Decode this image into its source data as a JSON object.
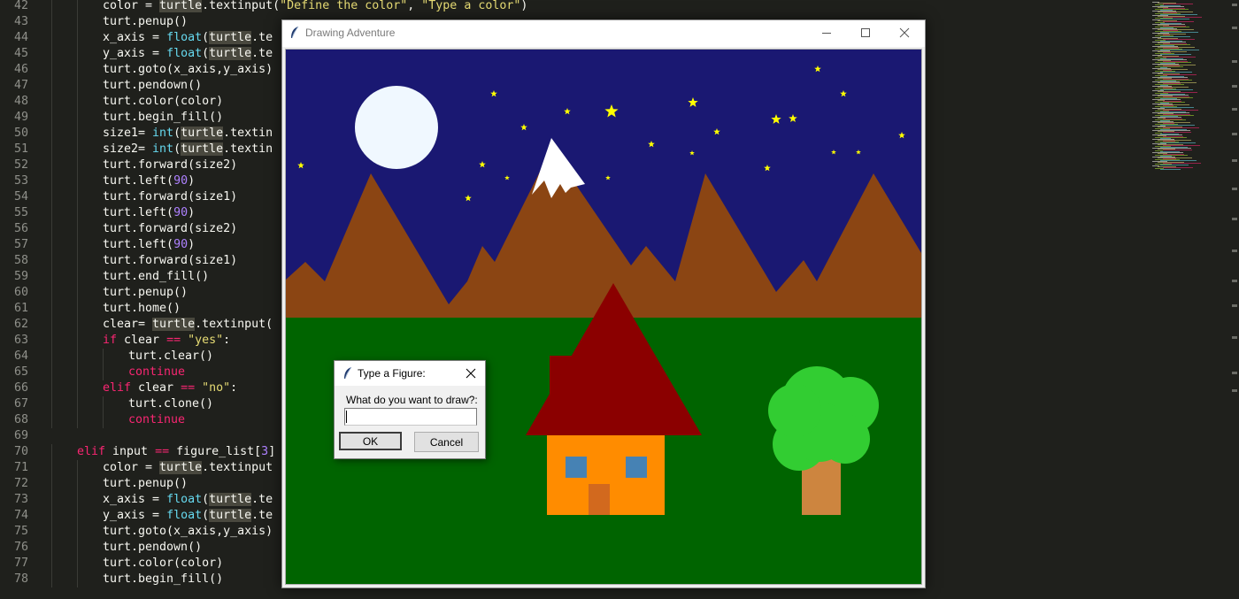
{
  "editor": {
    "lines": [
      {
        "n": "42",
        "indent": 2,
        "tokens": [
          [
            "p",
            "color = "
          ],
          [
            "hl",
            "turtle"
          ],
          [
            "p",
            ".textinput("
          ],
          [
            "s",
            "\"Define the color\""
          ],
          [
            "p",
            ", "
          ],
          [
            "s",
            "\"Type a color\""
          ],
          [
            "p",
            ")"
          ]
        ]
      },
      {
        "n": "43",
        "indent": 2,
        "tokens": [
          [
            "p",
            "turt.penup()"
          ]
        ]
      },
      {
        "n": "44",
        "indent": 2,
        "tokens": [
          [
            "p",
            "x_axis = "
          ],
          [
            "f",
            "float"
          ],
          [
            "p",
            "("
          ],
          [
            "hl",
            "turtle"
          ],
          [
            "p",
            ".te"
          ]
        ]
      },
      {
        "n": "45",
        "indent": 2,
        "tokens": [
          [
            "p",
            "y_axis = "
          ],
          [
            "f",
            "float"
          ],
          [
            "p",
            "("
          ],
          [
            "hl",
            "turtle"
          ],
          [
            "p",
            ".te"
          ]
        ]
      },
      {
        "n": "46",
        "indent": 2,
        "tokens": [
          [
            "p",
            "turt.goto(x_axis,y_axis)"
          ]
        ]
      },
      {
        "n": "47",
        "indent": 2,
        "tokens": [
          [
            "p",
            "turt.pendown()"
          ]
        ]
      },
      {
        "n": "48",
        "indent": 2,
        "tokens": [
          [
            "p",
            "turt.color(color)"
          ]
        ]
      },
      {
        "n": "49",
        "indent": 2,
        "tokens": [
          [
            "p",
            "turt.begin_fill()"
          ]
        ]
      },
      {
        "n": "50",
        "indent": 2,
        "tokens": [
          [
            "p",
            "size1= "
          ],
          [
            "f",
            "int"
          ],
          [
            "p",
            "("
          ],
          [
            "hl",
            "turtle"
          ],
          [
            "p",
            ".textin"
          ]
        ]
      },
      {
        "n": "51",
        "indent": 2,
        "tokens": [
          [
            "p",
            "size2= "
          ],
          [
            "f",
            "int"
          ],
          [
            "p",
            "("
          ],
          [
            "hl",
            "turtle"
          ],
          [
            "p",
            ".textin"
          ]
        ]
      },
      {
        "n": "52",
        "indent": 2,
        "tokens": [
          [
            "p",
            "turt.forward(size2)"
          ]
        ]
      },
      {
        "n": "53",
        "indent": 2,
        "tokens": [
          [
            "p",
            "turt.left("
          ],
          [
            "n",
            "90"
          ],
          [
            "p",
            ")"
          ]
        ]
      },
      {
        "n": "54",
        "indent": 2,
        "tokens": [
          [
            "p",
            "turt.forward(size1)"
          ]
        ]
      },
      {
        "n": "55",
        "indent": 2,
        "tokens": [
          [
            "p",
            "turt.left("
          ],
          [
            "n",
            "90"
          ],
          [
            "p",
            ")"
          ]
        ]
      },
      {
        "n": "56",
        "indent": 2,
        "tokens": [
          [
            "p",
            "turt.forward(size2)"
          ]
        ]
      },
      {
        "n": "57",
        "indent": 2,
        "tokens": [
          [
            "p",
            "turt.left("
          ],
          [
            "n",
            "90"
          ],
          [
            "p",
            ")"
          ]
        ]
      },
      {
        "n": "58",
        "indent": 2,
        "tokens": [
          [
            "p",
            "turt.forward(size1)"
          ]
        ]
      },
      {
        "n": "59",
        "indent": 2,
        "tokens": [
          [
            "p",
            "turt.end_fill()"
          ]
        ]
      },
      {
        "n": "60",
        "indent": 2,
        "tokens": [
          [
            "p",
            "turt.penup()"
          ]
        ]
      },
      {
        "n": "61",
        "indent": 2,
        "tokens": [
          [
            "p",
            "turt.home()"
          ]
        ]
      },
      {
        "n": "62",
        "indent": 2,
        "tokens": [
          [
            "p",
            "clear= "
          ],
          [
            "hl",
            "turtle"
          ],
          [
            "p",
            ".textinput("
          ]
        ]
      },
      {
        "n": "63",
        "indent": 2,
        "tokens": [
          [
            "k",
            "if"
          ],
          [
            "p",
            " clear "
          ],
          [
            "k",
            "=="
          ],
          [
            "p",
            " "
          ],
          [
            "s",
            "\"yes\""
          ],
          [
            "p",
            ":"
          ]
        ]
      },
      {
        "n": "64",
        "indent": 3,
        "tokens": [
          [
            "p",
            "turt.clear()"
          ]
        ]
      },
      {
        "n": "65",
        "indent": 3,
        "tokens": [
          [
            "k",
            "continue"
          ]
        ]
      },
      {
        "n": "66",
        "indent": 2,
        "tokens": [
          [
            "k",
            "elif"
          ],
          [
            "p",
            " clear "
          ],
          [
            "k",
            "=="
          ],
          [
            "p",
            " "
          ],
          [
            "s",
            "\"no\""
          ],
          [
            "p",
            ":"
          ]
        ]
      },
      {
        "n": "67",
        "indent": 3,
        "tokens": [
          [
            "p",
            "turt.clone()"
          ]
        ]
      },
      {
        "n": "68",
        "indent": 3,
        "tokens": [
          [
            "k",
            "continue"
          ]
        ]
      },
      {
        "n": "69",
        "indent": 0,
        "tokens": []
      },
      {
        "n": "70",
        "indent": 1,
        "tokens": [
          [
            "k",
            "elif"
          ],
          [
            "p",
            " input "
          ],
          [
            "k",
            "=="
          ],
          [
            "p",
            " figure_list["
          ],
          [
            "n",
            "3"
          ],
          [
            "p",
            "]"
          ]
        ]
      },
      {
        "n": "71",
        "indent": 2,
        "tokens": [
          [
            "p",
            "color = "
          ],
          [
            "hl",
            "turtle"
          ],
          [
            "p",
            ".textinput"
          ]
        ]
      },
      {
        "n": "72",
        "indent": 2,
        "tokens": [
          [
            "p",
            "turt.penup()"
          ]
        ]
      },
      {
        "n": "73",
        "indent": 2,
        "tokens": [
          [
            "p",
            "x_axis = "
          ],
          [
            "f",
            "float"
          ],
          [
            "p",
            "("
          ],
          [
            "hl",
            "turtle"
          ],
          [
            "p",
            ".te"
          ]
        ]
      },
      {
        "n": "74",
        "indent": 2,
        "tokens": [
          [
            "p",
            "y_axis = "
          ],
          [
            "f",
            "float"
          ],
          [
            "p",
            "("
          ],
          [
            "hl",
            "turtle"
          ],
          [
            "p",
            ".te"
          ]
        ]
      },
      {
        "n": "75",
        "indent": 2,
        "tokens": [
          [
            "p",
            "turt.goto(x_axis,y_axis)"
          ]
        ]
      },
      {
        "n": "76",
        "indent": 2,
        "tokens": [
          [
            "p",
            "turt.pendown()"
          ]
        ]
      },
      {
        "n": "77",
        "indent": 2,
        "tokens": [
          [
            "p",
            "turt.color(color)"
          ]
        ]
      },
      {
        "n": "78",
        "indent": 2,
        "tokens": [
          [
            "p",
            "turt.begin_fill()"
          ]
        ]
      }
    ]
  },
  "turtle_window": {
    "title": "Drawing Adventure",
    "icons": {
      "app": "feather-icon",
      "minimize": "minimize-icon",
      "maximize": "maximize-icon",
      "close": "close-icon"
    }
  },
  "drawing": {
    "colors": {
      "sky": "#1a1872",
      "mountain": "#8b4513",
      "snow": "#ffffff",
      "grass": "#006400",
      "moon": "#f0f8ff",
      "star": "#ffff00",
      "roof": "#8b0000",
      "wall": "#ff8c00",
      "window": "#4682b4",
      "door": "#d2691e",
      "trunk": "#cd853f",
      "leaves": "#32cd32"
    },
    "star_count": 22
  },
  "dialog": {
    "title": "Type a Figure:",
    "prompt": "What do you want to draw?:",
    "input_value": "",
    "ok_label": "OK",
    "cancel_label": "Cancel",
    "icons": {
      "app": "feather-icon",
      "close": "close-icon"
    }
  }
}
